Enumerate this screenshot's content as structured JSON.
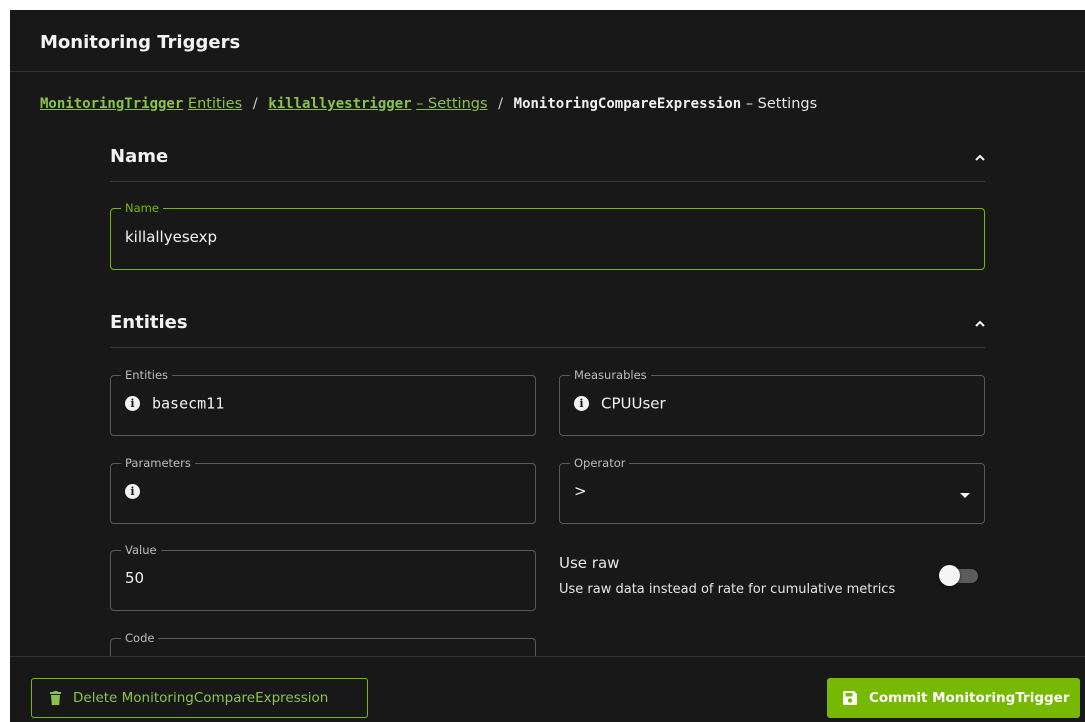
{
  "header": {
    "title": "Monitoring Triggers"
  },
  "breadcrumb": {
    "item1_code": "MonitoringTrigger",
    "item1_text": "Entities",
    "sep": "/",
    "item2_code": "killallyestrigger",
    "item2_text": "– Settings",
    "item3_code": "MonitoringCompareExpression",
    "item3_text": "– Settings"
  },
  "sections": {
    "name": {
      "title": "Name"
    },
    "entities": {
      "title": "Entities"
    }
  },
  "fields": {
    "name": {
      "label": "Name",
      "value": "killallyesexp"
    },
    "entities": {
      "label": "Entities",
      "value": "basecm11"
    },
    "measurables": {
      "label": "Measurables",
      "value": "CPUUser"
    },
    "parameters": {
      "label": "Parameters",
      "value": ""
    },
    "operator": {
      "label": "Operator",
      "value": ">"
    },
    "value": {
      "label": "Value",
      "value": "50"
    },
    "code": {
      "label": "Code",
      "value": ""
    }
  },
  "use_raw": {
    "title": "Use raw",
    "description": "Use raw data instead of rate for cumulative metrics",
    "enabled": false
  },
  "footer": {
    "delete_label": "Delete MonitoringCompareExpression",
    "commit_label": "Commit MonitoringTrigger"
  },
  "icons": {
    "info": "info-icon",
    "chevron": "chevron-up-icon",
    "delete": "trash-icon",
    "commit": "save-icon"
  },
  "colors": {
    "accent": "#76b900",
    "background": "#181818"
  }
}
